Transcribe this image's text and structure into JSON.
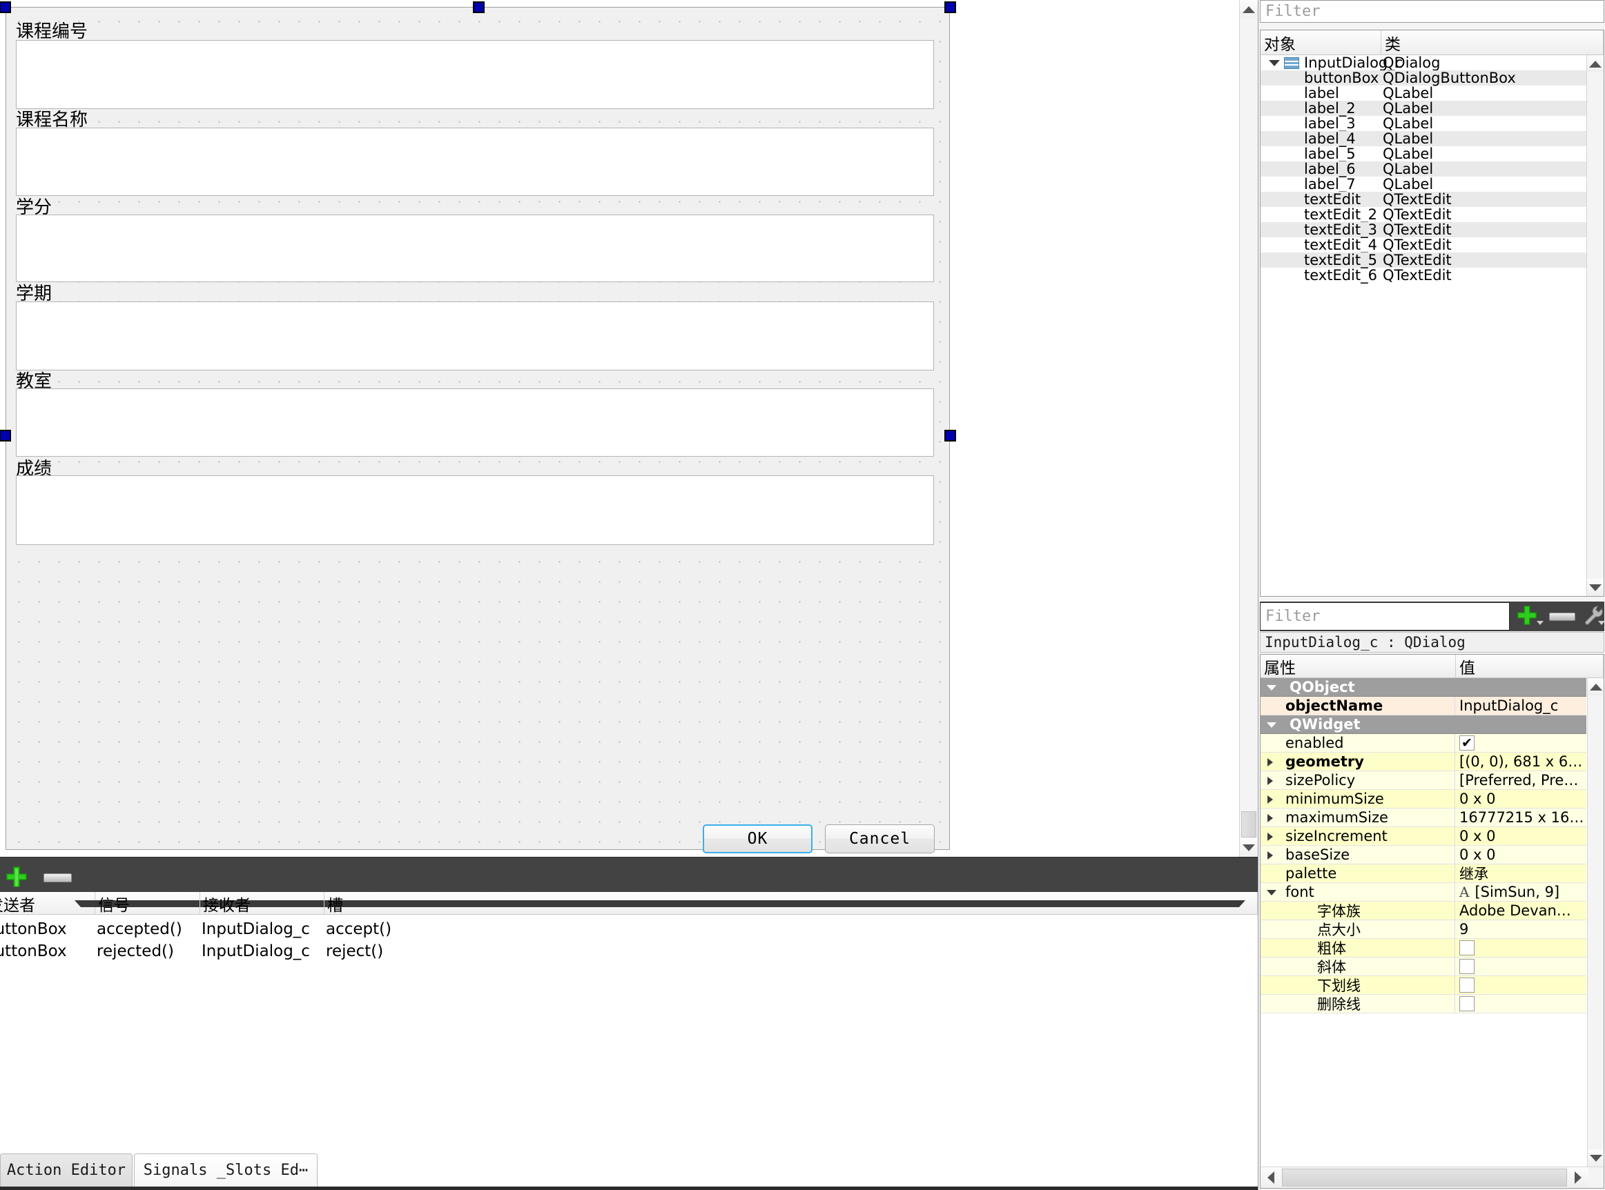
{
  "form": {
    "fields": [
      {
        "label": "课程编号"
      },
      {
        "label": "课程名称"
      },
      {
        "label": "学分"
      },
      {
        "label": "学期"
      },
      {
        "label": "教室"
      },
      {
        "label": "成绩"
      }
    ],
    "buttons": {
      "ok": "OK",
      "cancel": "Cancel"
    }
  },
  "signal_slot_editor": {
    "columns": [
      "发送者",
      "信号",
      "接收者",
      "槽"
    ],
    "rows": [
      {
        "sender": "buttonBox",
        "signal": "accepted()",
        "receiver": "InputDialog_c",
        "slot": "accept()"
      },
      {
        "sender": "buttonBox",
        "signal": "rejected()",
        "receiver": "InputDialog_c",
        "slot": "reject()"
      }
    ]
  },
  "bottom_tabs": [
    {
      "label": "Action Editor",
      "active": false
    },
    {
      "label": "Signals _Slots Ed⋯",
      "active": true
    }
  ],
  "object_inspector": {
    "filter_placeholder": "Filter",
    "columns": [
      "对象",
      "类"
    ],
    "rows": [
      {
        "name": "InputDialog_c",
        "class": "QDialog"
      },
      {
        "name": "buttonBox",
        "class": "QDialogButtonBox"
      },
      {
        "name": "label",
        "class": "QLabel"
      },
      {
        "name": "label_2",
        "class": "QLabel"
      },
      {
        "name": "label_3",
        "class": "QLabel"
      },
      {
        "name": "label_4",
        "class": "QLabel"
      },
      {
        "name": "label_5",
        "class": "QLabel"
      },
      {
        "name": "label_6",
        "class": "QLabel"
      },
      {
        "name": "label_7",
        "class": "QLabel"
      },
      {
        "name": "textEdit",
        "class": "QTextEdit"
      },
      {
        "name": "textEdit_2",
        "class": "QTextEdit"
      },
      {
        "name": "textEdit_3",
        "class": "QTextEdit"
      },
      {
        "name": "textEdit_4",
        "class": "QTextEdit"
      },
      {
        "name": "textEdit_5",
        "class": "QTextEdit"
      },
      {
        "name": "textEdit_6",
        "class": "QTextEdit"
      }
    ]
  },
  "property_editor": {
    "filter_placeholder": "Filter",
    "object_line": "InputDialog_c : QDialog",
    "columns": [
      "属性",
      "值"
    ],
    "rows": [
      {
        "key": "QObject",
        "value": "",
        "kind": "group"
      },
      {
        "key": "objectName",
        "value": "InputDialog_c",
        "kind": "name"
      },
      {
        "key": "QWidget",
        "value": "",
        "kind": "group"
      },
      {
        "key": "enabled",
        "value": "",
        "kind": "check",
        "checked": true
      },
      {
        "key": "geometry",
        "value": "[(0, 0), 681 x 6…",
        "kind": "expand-bold"
      },
      {
        "key": "sizePolicy",
        "value": "[Preferred, Pre…",
        "kind": "expand"
      },
      {
        "key": "minimumSize",
        "value": "0 x 0",
        "kind": "expand"
      },
      {
        "key": "maximumSize",
        "value": "16777215 x 16…",
        "kind": "expand"
      },
      {
        "key": "sizeIncrement",
        "value": "0 x 0",
        "kind": "expand"
      },
      {
        "key": "baseSize",
        "value": "0 x 0",
        "kind": "expand"
      },
      {
        "key": "palette",
        "value": "继承",
        "kind": "plain"
      },
      {
        "key": "font",
        "value": "[SimSun, 9]",
        "kind": "font-open"
      },
      {
        "key": "字体族",
        "value": "Adobe Devan…",
        "kind": "sub"
      },
      {
        "key": "点大小",
        "value": "9",
        "kind": "sub"
      },
      {
        "key": "粗体",
        "value": "",
        "kind": "sub-check",
        "checked": false
      },
      {
        "key": "斜体",
        "value": "",
        "kind": "sub-check",
        "checked": false
      },
      {
        "key": "下划线",
        "value": "",
        "kind": "sub-check",
        "checked": false
      },
      {
        "key": "删除线",
        "value": "",
        "kind": "sub-check",
        "checked": false
      }
    ]
  }
}
